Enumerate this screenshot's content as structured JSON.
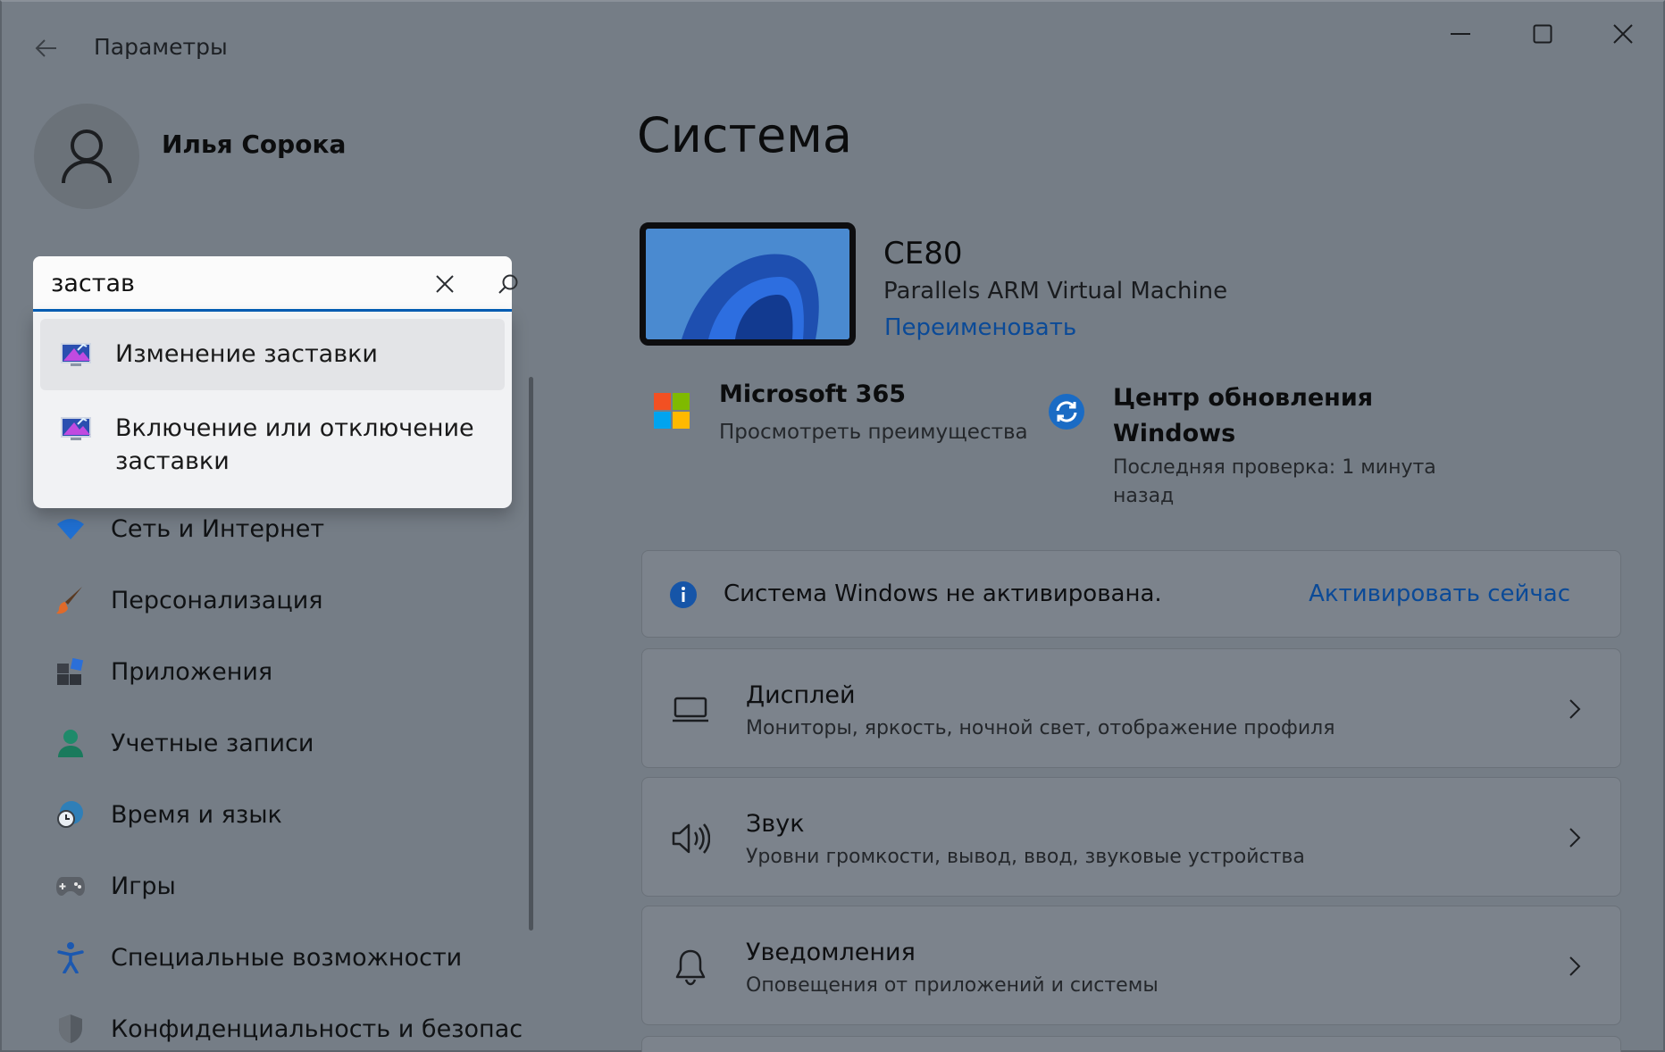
{
  "window": {
    "title": "Параметры"
  },
  "profile": {
    "name": "Илья Сорока"
  },
  "search": {
    "value": "застав",
    "suggestions": [
      {
        "label": "Изменение заставки",
        "icon": "screensaver-icon"
      },
      {
        "label": "Включение или отключение заставки",
        "icon": "screensaver-icon"
      }
    ]
  },
  "sidebar": {
    "items": [
      {
        "label": "Сеть и Интернет",
        "icon": "wifi-icon"
      },
      {
        "label": "Персонализация",
        "icon": "brush-icon"
      },
      {
        "label": "Приложения",
        "icon": "apps-icon"
      },
      {
        "label": "Учетные записи",
        "icon": "person-icon"
      },
      {
        "label": "Время и язык",
        "icon": "globe-clock-icon"
      },
      {
        "label": "Игры",
        "icon": "gamepad-icon"
      },
      {
        "label": "Специальные возможности",
        "icon": "accessibility-icon"
      },
      {
        "label": "Конфиденциальность и безопас",
        "icon": "shield-icon"
      }
    ]
  },
  "main": {
    "title": "Система",
    "device": {
      "name": "CE80",
      "model": "Parallels ARM Virtual Machine",
      "rename": "Переименовать"
    },
    "microsoft365": {
      "title": "Microsoft 365",
      "subtitle": "Просмотреть преимущества"
    },
    "update": {
      "title": "Центр обновления Windows",
      "subtitle": "Последняя проверка: 1 минута назад"
    },
    "activation": {
      "text": "Система Windows не активирована.",
      "action": "Активировать сейчас"
    },
    "cards": [
      {
        "title": "Дисплей",
        "subtitle": "Мониторы, яркость, ночной свет, отображение профиля",
        "icon": "monitor-icon"
      },
      {
        "title": "Звук",
        "subtitle": "Уровни громкости, вывод, ввод, звуковые устройства",
        "icon": "speaker-icon"
      },
      {
        "title": "Уведомления",
        "subtitle": "Оповещения от приложений и системы",
        "icon": "bell-icon"
      }
    ]
  },
  "colors": {
    "accent": "#005fb8",
    "link": "#0b4a97",
    "background": "#757d86"
  }
}
